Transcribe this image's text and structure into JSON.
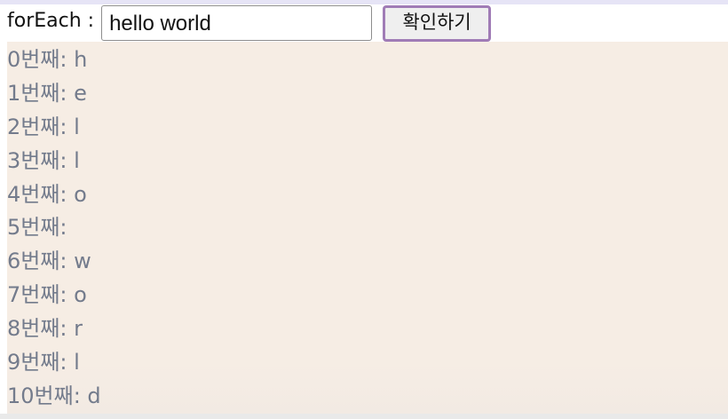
{
  "form": {
    "label": "forEach :",
    "input_value": "hello world",
    "button_label": "확인하기"
  },
  "results": [
    "0번째: h",
    "1번째: e",
    "2번째: l",
    "3번째: l",
    "4번째: o",
    "5번째:  ",
    "6번째: w",
    "7번째: o",
    "8번째: r",
    "9번째: l",
    "10번째: d"
  ],
  "colors": {
    "result_background": "#f6ede4",
    "result_text": "#737b8c",
    "button_border": "#a07cb6",
    "top_strip": "#e6e4f6"
  }
}
